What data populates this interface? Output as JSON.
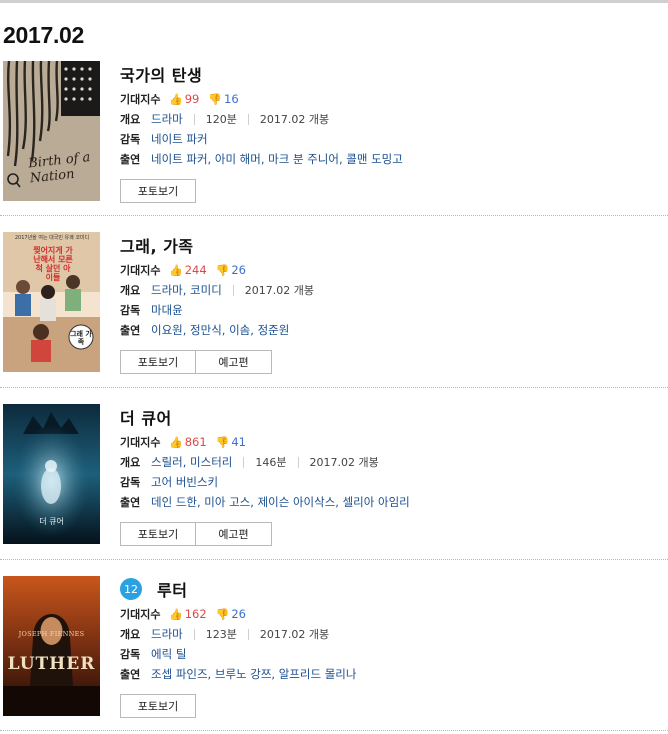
{
  "month_heading": "2017.02",
  "labels": {
    "expect": "기대지수",
    "summary": "개요",
    "director": "감독",
    "cast": "출연",
    "photo_btn": "포토보기",
    "trailer_btn": "예고편"
  },
  "icons": {
    "like": "thumbs-up-icon",
    "dislike": "thumbs-down-icon"
  },
  "colors": {
    "like": "#e04848",
    "dislike": "#3d6fd1",
    "link": "#1a4f8f",
    "age_badge": "#2aa1e1"
  },
  "movies": [
    {
      "title": "국가의 탄생",
      "likes": "99",
      "dislikes": "16",
      "genre": "드라마",
      "runtime": "120분",
      "release": "2017.02 개봉",
      "director": "네이트 파커",
      "cast": "네이트 파커, 아미 해머, 마크 분 주니어, 콜맨 도밍고",
      "poster_text": "Birth of a Nation"
    },
    {
      "title": "그래, 가족",
      "likes": "244",
      "dislikes": "26",
      "genre": "드라마, 코미디",
      "release": "2017.02 개봉",
      "director": "마대윤",
      "cast": "이요원, 정만식, 이솜, 정준원",
      "poster_text_top": "2017년을 여는 대국민 유쾌 코미디",
      "poster_text_mid": "찢어지게 가난해서 모른 척 살던 아이들",
      "poster_text_title": "그래 가족"
    },
    {
      "title": "더 큐어",
      "likes": "861",
      "dislikes": "41",
      "genre": "스릴러, 미스터리",
      "runtime": "146분",
      "release": "2017.02 개봉",
      "director": "고어 버빈스키",
      "cast": "데인 드한, 미아 고스, 제이슨 아이삭스, 셀리아 아임리",
      "poster_text": "더 큐어"
    },
    {
      "title": "루터",
      "age_rating": "12",
      "likes": "162",
      "dislikes": "26",
      "genre": "드라마",
      "runtime": "123분",
      "release": "2017.02 개봉",
      "director": "에릭 틸",
      "cast": "조셉 파인즈, 브루노 강쯔, 알프리드 몰리나",
      "poster_actor": "JOSEPH FIENNES",
      "poster_title": "LUTHER"
    }
  ]
}
